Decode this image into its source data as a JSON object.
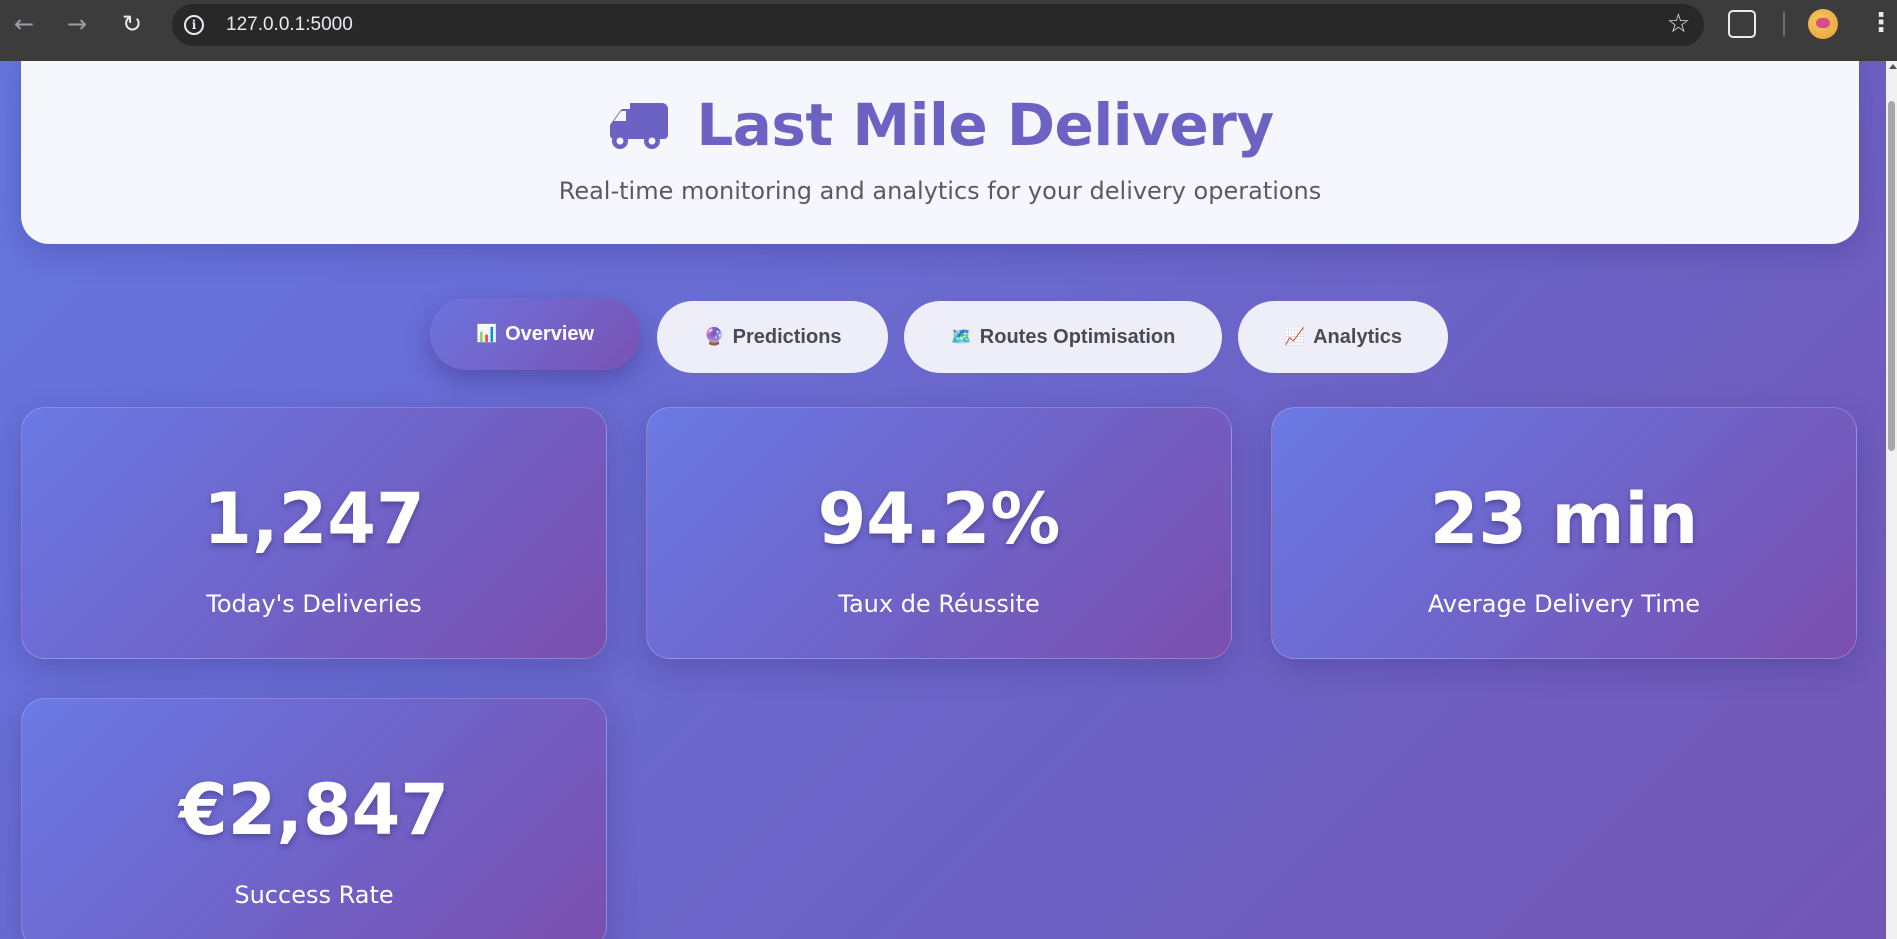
{
  "browser": {
    "url": "127.0.0.1:5000",
    "icons": [
      "back-icon",
      "forward-icon",
      "reload-icon",
      "info-icon",
      "star-icon",
      "extensions-icon",
      "profile-avatar",
      "menu-icon"
    ]
  },
  "header": {
    "title": "Last Mile Delivery",
    "subtitle": "Real-time monitoring and analytics for your delivery operations",
    "icon": "truck-icon"
  },
  "tabs": [
    {
      "emoji": "📊",
      "label": "Overview",
      "active": true
    },
    {
      "emoji": "🔮",
      "label": "Predictions",
      "active": false
    },
    {
      "emoji": "🗺️",
      "label": "Routes Optimisation",
      "active": false
    },
    {
      "emoji": "📈",
      "label": "Analytics",
      "active": false
    }
  ],
  "stats": [
    {
      "value": "1,247",
      "label": "Today's Deliveries"
    },
    {
      "value": "94.2%",
      "label": "Taux de Réussite"
    },
    {
      "value": "23 min",
      "label": "Average Delivery Time"
    },
    {
      "value": "€2,847",
      "label": "Success Rate"
    }
  ],
  "colors": {
    "title": "#6b62c4",
    "gradient_start": "#667eea",
    "gradient_end": "#764ba2"
  }
}
